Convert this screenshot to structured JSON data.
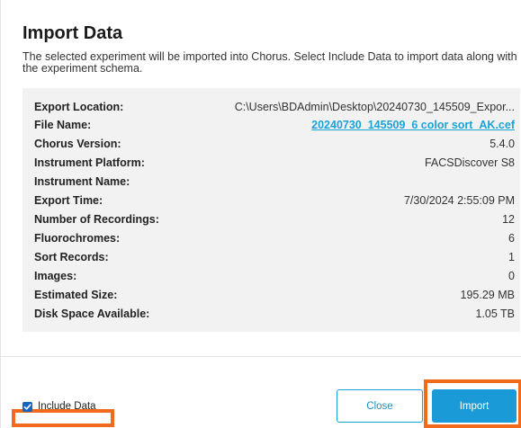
{
  "dialog": {
    "title": "Import Data",
    "description": "The selected experiment will be imported into Chorus. Select Include Data to import data along with the experiment schema."
  },
  "details": [
    {
      "label": "Export Location:",
      "value": "C:\\Users\\BDAdmin\\Desktop\\20240730_145509_Expor..."
    },
    {
      "label": "File Name:",
      "value": "20240730_145509_6 color sort_AK.cef"
    },
    {
      "label": "Chorus Version:",
      "value": "5.4.0"
    },
    {
      "label": "Instrument Platform:",
      "value": "FACSDiscover S8"
    },
    {
      "label": "Instrument Name:",
      "value": ""
    },
    {
      "label": "Export Time:",
      "value": "7/30/2024 2:55:09 PM"
    },
    {
      "label": "Number of Recordings:",
      "value": "12"
    },
    {
      "label": "Fluorochromes:",
      "value": "6"
    },
    {
      "label": "Sort Records:",
      "value": "1"
    },
    {
      "label": "Images:",
      "value": "0"
    },
    {
      "label": "Estimated Size:",
      "value": "195.29 MB"
    },
    {
      "label": "Disk Space Available:",
      "value": "1.05 TB"
    }
  ],
  "footer": {
    "include_data_label": "Include Data",
    "include_data_checked": true,
    "close_label": "Close",
    "import_label": "Import"
  },
  "colors": {
    "accent": "#1a9ad6",
    "link": "#1aa3d9",
    "highlight": "#f26b1d",
    "panel_bg": "#f2f2f2",
    "checkbox": "#1565c0"
  }
}
